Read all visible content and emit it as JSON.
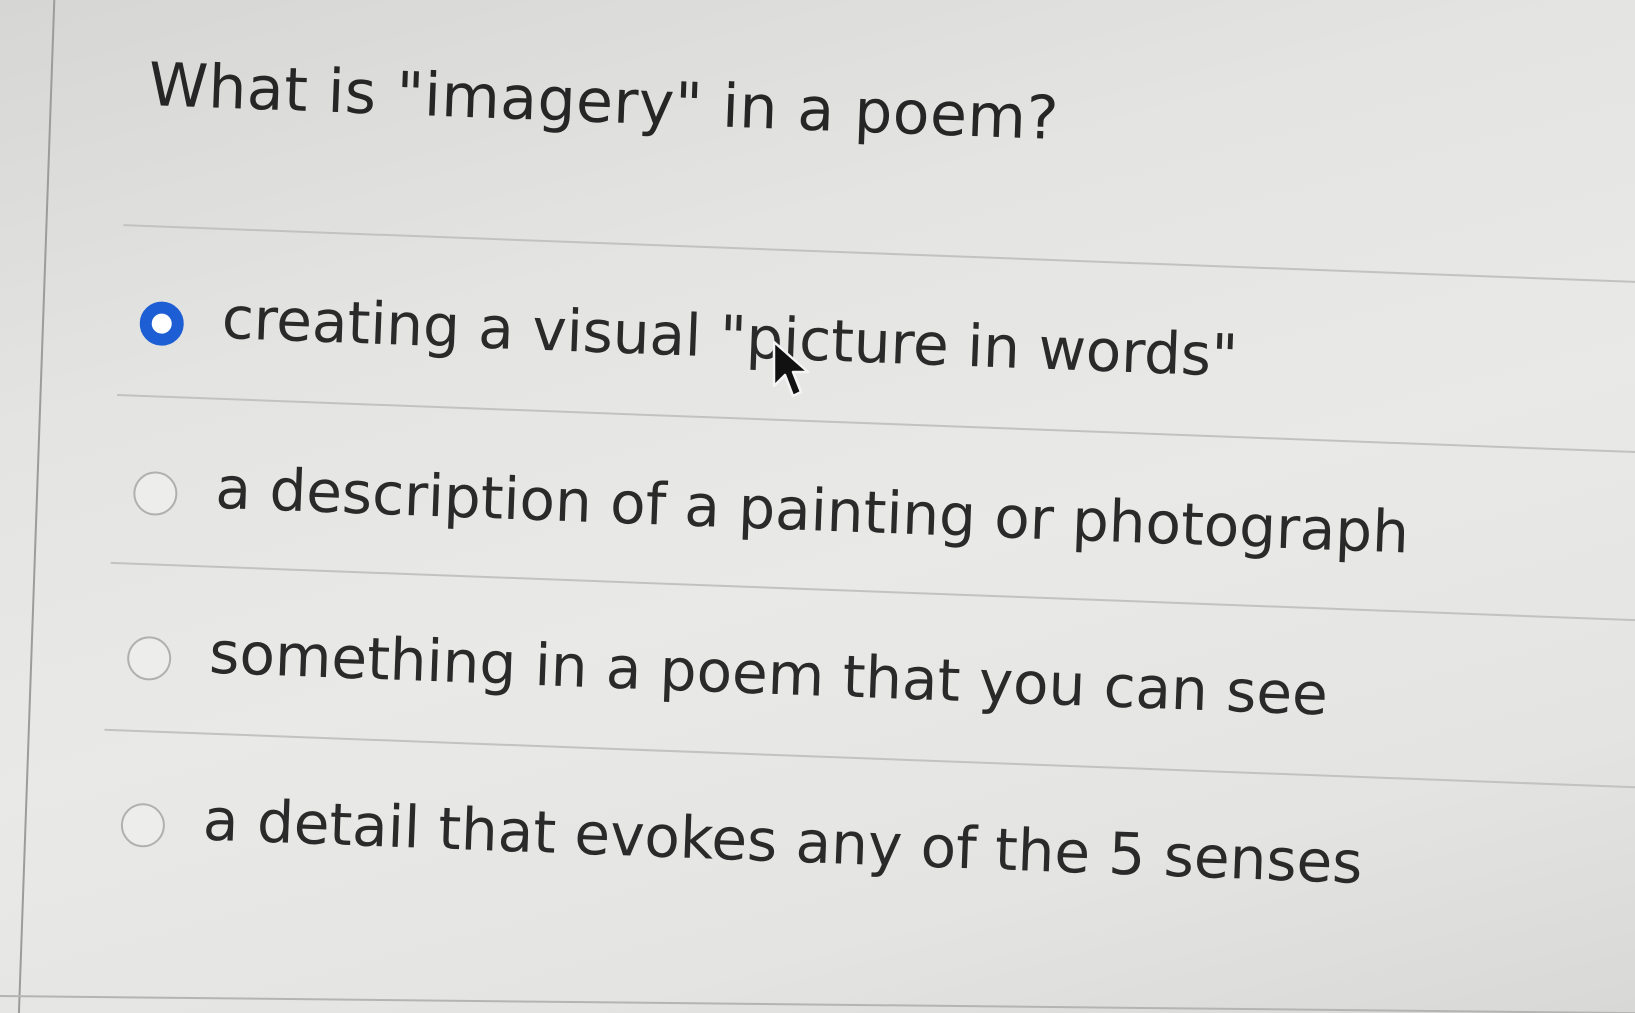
{
  "question": {
    "text": "What is \"imagery\" in a poem?"
  },
  "options": [
    {
      "label": "creating a visual \"picture in words\"",
      "selected": true
    },
    {
      "label": "a description of a painting or photograph",
      "selected": false
    },
    {
      "label": "something in a poem that you can see",
      "selected": false
    },
    {
      "label": "a detail that evokes any of the 5 senses",
      "selected": false
    }
  ],
  "colors": {
    "accent": "#1d5ed4",
    "text": "#262626",
    "background": "#e6e6e4"
  },
  "icons": {
    "cursor": "mouse-pointer-icon"
  }
}
